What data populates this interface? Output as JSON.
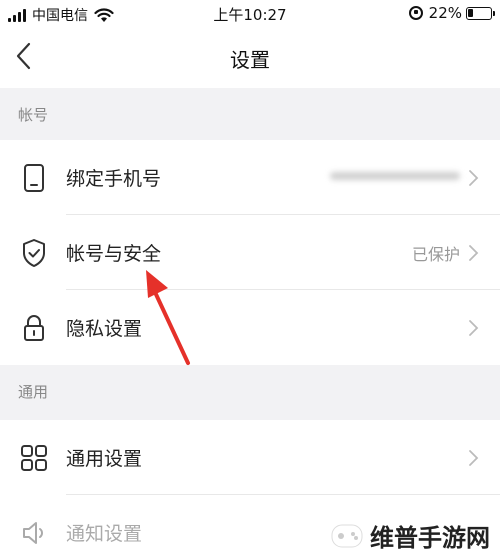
{
  "status_bar": {
    "carrier": "中国电信",
    "time": "上午10:27",
    "battery_percent": "22%",
    "battery_level": 0.22,
    "icons": [
      "signal-icon",
      "wifi-icon",
      "orientation-lock-icon",
      "battery-icon"
    ]
  },
  "nav": {
    "title": "设置",
    "back_icon": "chevron-left-icon"
  },
  "sections": {
    "account": {
      "header": "帐号",
      "rows": [
        {
          "label": "绑定手机号",
          "value": "",
          "icon": "phone-icon"
        },
        {
          "label": "帐号与安全",
          "value": "已保护",
          "icon": "shield-check-icon"
        },
        {
          "label": "隐私设置",
          "value": "",
          "icon": "lock-icon"
        }
      ]
    },
    "general": {
      "header": "通用",
      "rows": [
        {
          "label": "通用设置",
          "value": "",
          "icon": "grid-icon"
        },
        {
          "label": "通知设置",
          "value": "",
          "icon": "speaker-icon"
        }
      ]
    }
  },
  "annotation": {
    "arrow_color": "#e5312a"
  },
  "watermark": {
    "text": "维普手游网"
  }
}
